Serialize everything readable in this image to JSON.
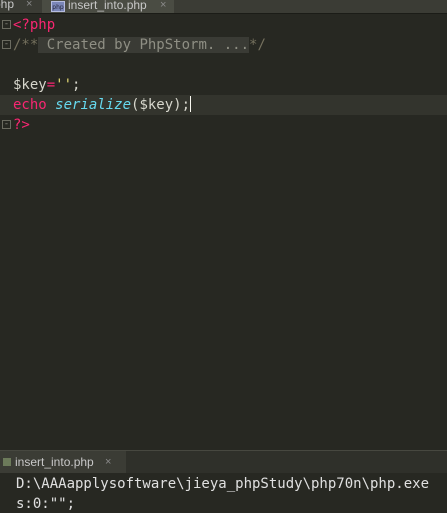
{
  "tabs": [
    {
      "label": "php",
      "close": "×"
    },
    {
      "label": "insert_into.php",
      "close": "×",
      "icon": "php-file-icon",
      "active": true
    }
  ],
  "editor": {
    "line1": "<?php",
    "line2_comment_start": "/**",
    "line2_folded": " Created by PhpStorm. ...",
    "line2_comment_end": "*/",
    "line4_var": "$key",
    "line4_op": "=",
    "line4_str": "''",
    "line4_end": ";",
    "line5_kw": "echo",
    "line5_fn": "serialize",
    "line5_args": "($key);",
    "line6": "?>"
  },
  "fold_markers": {
    "open": "-",
    "close": "-"
  },
  "run_panel": {
    "tab_label": "insert_into.php",
    "tab_close": "×",
    "console_lines": [
      "D:\\AAAapplysoftware\\jieya_phpStudy\\php70n\\php.exe",
      "s:0:\"\";"
    ]
  },
  "colors": {
    "background": "#272822",
    "keyword": "#f92672",
    "function": "#66d9ef",
    "string": "#e6db74",
    "comment": "#75715e"
  }
}
